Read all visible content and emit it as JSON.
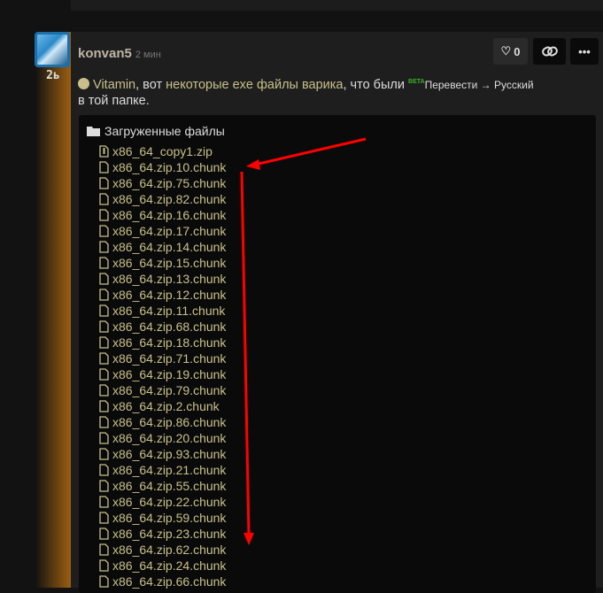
{
  "post": {
    "author": "konvan5",
    "time": "2 мин",
    "rank": "2ь",
    "like_count": "0",
    "mention": "Vitamin",
    "text_1": ", вот ",
    "link_text": "некоторые exe файлы варика",
    "text_2": ", что были",
    "text_3": "в той папке.",
    "beta_label": "BETA",
    "translate_label": "Перевести → Русский"
  },
  "attachments": {
    "folder_title": "Загруженные файлы",
    "files": [
      {
        "name": "x86_64_copy1.zip",
        "icon": "zip-file-icon"
      },
      {
        "name": "x86_64.zip.10.chunk",
        "icon": "file-icon"
      },
      {
        "name": "x86_64.zip.75.chunk",
        "icon": "file-icon"
      },
      {
        "name": "x86_64.zip.82.chunk",
        "icon": "file-icon"
      },
      {
        "name": "x86_64.zip.16.chunk",
        "icon": "file-icon"
      },
      {
        "name": "x86_64.zip.17.chunk",
        "icon": "file-icon"
      },
      {
        "name": "x86_64.zip.14.chunk",
        "icon": "file-icon"
      },
      {
        "name": "x86_64.zip.15.chunk",
        "icon": "file-icon"
      },
      {
        "name": "x86_64.zip.13.chunk",
        "icon": "file-icon"
      },
      {
        "name": "x86_64.zip.12.chunk",
        "icon": "file-icon"
      },
      {
        "name": "x86_64.zip.11.chunk",
        "icon": "file-icon"
      },
      {
        "name": "x86_64.zip.68.chunk",
        "icon": "file-icon"
      },
      {
        "name": "x86_64.zip.18.chunk",
        "icon": "file-icon"
      },
      {
        "name": "x86_64.zip.71.chunk",
        "icon": "file-icon"
      },
      {
        "name": "x86_64.zip.19.chunk",
        "icon": "file-icon"
      },
      {
        "name": "x86_64.zip.79.chunk",
        "icon": "file-icon"
      },
      {
        "name": "x86_64.zip.2.chunk",
        "icon": "file-icon"
      },
      {
        "name": "x86_64.zip.86.chunk",
        "icon": "file-icon"
      },
      {
        "name": "x86_64.zip.20.chunk",
        "icon": "file-icon"
      },
      {
        "name": "x86_64.zip.93.chunk",
        "icon": "file-icon"
      },
      {
        "name": "x86_64.zip.21.chunk",
        "icon": "file-icon"
      },
      {
        "name": "x86_64.zip.55.chunk",
        "icon": "file-icon"
      },
      {
        "name": "x86_64.zip.22.chunk",
        "icon": "file-icon"
      },
      {
        "name": "x86_64.zip.59.chunk",
        "icon": "file-icon"
      },
      {
        "name": "x86_64.zip.23.chunk",
        "icon": "file-icon"
      },
      {
        "name": "x86_64.zip.62.chunk",
        "icon": "file-icon"
      },
      {
        "name": "x86_64.zip.24.chunk",
        "icon": "file-icon"
      },
      {
        "name": "x86_64.zip.66.chunk",
        "icon": "file-icon"
      }
    ]
  },
  "colors": {
    "accent": "#c8c08a",
    "annotation": "#ff0000",
    "background": "#1e1e1e"
  }
}
